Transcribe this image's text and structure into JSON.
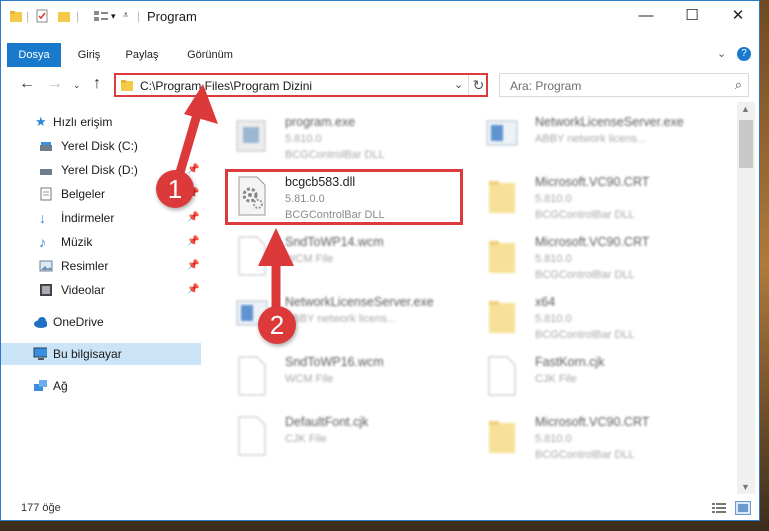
{
  "window": {
    "title": "Program"
  },
  "ribbon": {
    "tabs": [
      {
        "label": "Dosya",
        "active": true
      },
      {
        "label": "Giriş",
        "active": false
      },
      {
        "label": "Paylaş",
        "active": false
      },
      {
        "label": "Görünüm",
        "active": false
      }
    ]
  },
  "address": {
    "path": "C:\\Program Files\\Program Dizini"
  },
  "search": {
    "placeholder": "Ara: Program"
  },
  "nav": {
    "items": [
      {
        "label": "Hızlı erişim",
        "icon": "star-icon",
        "pinned": false
      },
      {
        "label": "Yerel Disk (C:)",
        "icon": "drive-icon",
        "pinned": false
      },
      {
        "label": "Yerel Disk (D:)",
        "icon": "drive-icon",
        "pinned": true
      },
      {
        "label": "Belgeler",
        "icon": "documents-icon",
        "pinned": true
      },
      {
        "label": "İndirmeler",
        "icon": "download-icon",
        "pinned": true
      },
      {
        "label": "Müzik",
        "icon": "music-icon",
        "pinned": true
      },
      {
        "label": "Resimler",
        "icon": "pictures-icon",
        "pinned": true
      },
      {
        "label": "Videolar",
        "icon": "video-icon",
        "pinned": true
      },
      {
        "label": "OneDrive",
        "icon": "cloud-icon",
        "pinned": false
      },
      {
        "label": "Bu bilgisayar",
        "icon": "computer-icon",
        "pinned": false
      },
      {
        "label": "Ağ",
        "icon": "network-icon",
        "pinned": false
      }
    ]
  },
  "files": [
    {
      "name": "program.exe",
      "line1": "5.810.0",
      "line2": "BCGControlBar DLL",
      "type": "exe"
    },
    {
      "name": "NetworkLicenseServer.exe",
      "line1": "ABBY network licens...",
      "line2": "",
      "type": "exe"
    },
    {
      "name": "bcgcb583.dll",
      "line1": "5.81.0.0",
      "line2": "BCGControlBar DLL",
      "type": "dll"
    },
    {
      "name": "Microsoft.VC90.CRT",
      "line1": "5.810.0",
      "line2": "BCGControlBar DLL",
      "type": "folder"
    },
    {
      "name": "SndToWP14.wcm",
      "line1": "WCM File",
      "line2": "",
      "type": "doc"
    },
    {
      "name": "Microsoft.VC90.CRT",
      "line1": "5.810.0",
      "line2": "BCGControlBar DLL",
      "type": "folder"
    },
    {
      "name": "NetworkLicenseServer.exe",
      "line1": "ABBY network licens...",
      "line2": "",
      "type": "exe"
    },
    {
      "name": "x64",
      "line1": "5.810.0",
      "line2": "BCGControlBar DLL",
      "type": "folder"
    },
    {
      "name": "SndToWP16.wcm",
      "line1": "WCM File",
      "line2": "",
      "type": "doc"
    },
    {
      "name": "FastKorn.cjk",
      "line1": "CJK File",
      "line2": "",
      "type": "doc"
    },
    {
      "name": "DefaultFont.cjk",
      "line1": "CJK File",
      "line2": "",
      "type": "doc"
    },
    {
      "name": "Microsoft.VC90.CRT",
      "line1": "5.810.0",
      "line2": "BCGControlBar DLL",
      "type": "folder"
    }
  ],
  "status": {
    "count": "177 öğe"
  },
  "annotations": {
    "step1": "1",
    "step2": "2"
  },
  "colors": {
    "accent": "#1979ca",
    "highlight": "#dd3b3b",
    "selected": "#cce4f7"
  }
}
